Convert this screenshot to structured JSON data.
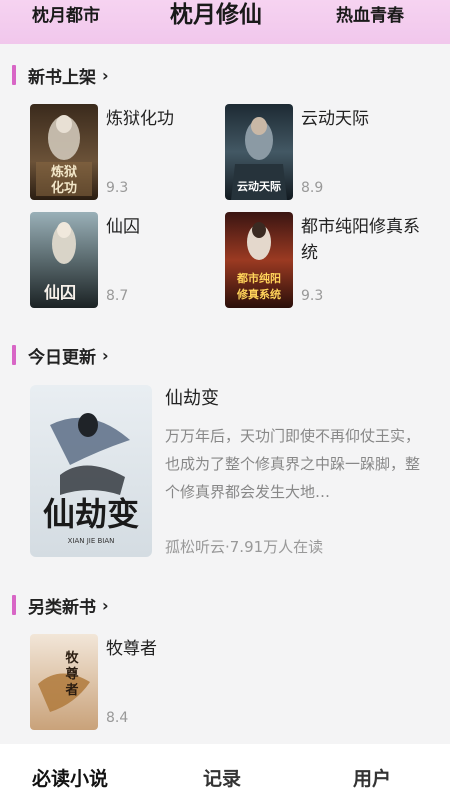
{
  "top_tabs": {
    "left": "枕月都市",
    "center": "枕月修仙",
    "right": "热血青春"
  },
  "sections": {
    "new_books": "新书上架",
    "today_updates": "今日更新",
    "alt_new": "另类新书"
  },
  "new_books": [
    {
      "title": "炼狱化功",
      "score": "9.3",
      "cover_text": "炼狱化功"
    },
    {
      "title": "云动天际",
      "score": "8.9",
      "cover_text": "云动天际"
    },
    {
      "title": "仙囚",
      "score": "8.7",
      "cover_text": "仙囚"
    },
    {
      "title": "都市纯阳修真系统",
      "score": "9.3",
      "cover_text": "都市纯阳修真系统"
    }
  ],
  "featured": {
    "title": "仙劫变",
    "description": "万万年后，天功门即使不再仰仗王实，也成为了整个修真界之中跺一跺脚，整个修真界都会发生大地…",
    "meta": "孤松听云·7.91万人在读",
    "cover_text": "仙劫变",
    "cover_sub": "XIAN JIE BIAN"
  },
  "alt_books": [
    {
      "title": "牧尊者",
      "score": "8.4",
      "cover_text": "牧尊者"
    }
  ],
  "chevron": "›",
  "bottom_nav": {
    "must_read": "必读小说",
    "history": "记录",
    "user": "用户"
  },
  "colors": {
    "accent": "#e55bd8",
    "section_bar": "#d866c6",
    "header_bg": "#f3c9ee"
  }
}
